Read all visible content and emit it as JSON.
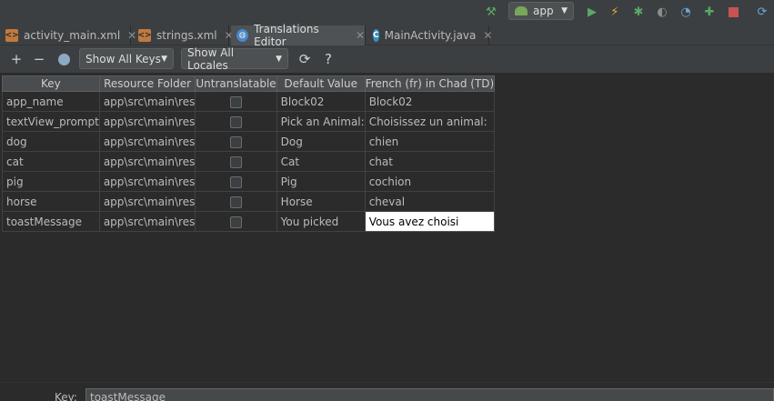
{
  "run_toolbar": {
    "config_label": "app",
    "icons": [
      "hammer-icon",
      "android-icon",
      "run-icon",
      "apply-changes-icon",
      "debug-icon",
      "coverage-icon",
      "profile-icon",
      "attach-debugger-icon",
      "stop-icon",
      "sync-icon"
    ],
    "colors": {
      "run": "#59a869",
      "stop": "#c75450",
      "debug": "#59a869",
      "hammer": "#59a869",
      "lightning": "#f0a732"
    }
  },
  "tabs": [
    {
      "label": "activity_main.xml",
      "icon": "xml-file-icon"
    },
    {
      "label": "strings.xml",
      "icon": "xml-file-icon"
    },
    {
      "label": "Translations Editor",
      "icon": "globe-icon",
      "active": true
    },
    {
      "label": "MainActivity.java",
      "icon": "class-icon"
    }
  ],
  "toolbar": {
    "add_label": "+",
    "remove_label": "−",
    "show_keys": "Show All Keys",
    "show_locales": "Show All Locales",
    "help_label": "?"
  },
  "table": {
    "headers": [
      "Key",
      "Resource Folder",
      "Untranslatable",
      "Default Value",
      "French (fr) in Chad (TD)"
    ],
    "rows": [
      {
        "key": "app_name",
        "folder": "app\\src\\main\\res",
        "untranslatable": false,
        "default": "Block02",
        "french": "Block02"
      },
      {
        "key": "textView_prompt",
        "folder": "app\\src\\main\\res",
        "untranslatable": false,
        "default": "Pick an Animal:",
        "french": "Choisissez un animal:"
      },
      {
        "key": "dog",
        "folder": "app\\src\\main\\res",
        "untranslatable": false,
        "default": "Dog",
        "french": "chien"
      },
      {
        "key": "cat",
        "folder": "app\\src\\main\\res",
        "untranslatable": false,
        "default": "Cat",
        "french": "chat"
      },
      {
        "key": "pig",
        "folder": "app\\src\\main\\res",
        "untranslatable": false,
        "default": "Pig",
        "french": "cochion"
      },
      {
        "key": "horse",
        "folder": "app\\src\\main\\res",
        "untranslatable": false,
        "default": "Horse",
        "french": "cheval"
      },
      {
        "key": "toastMessage",
        "folder": "app\\src\\main\\res",
        "untranslatable": false,
        "default": "You picked",
        "french": "Vous avez choisi",
        "editing": true
      }
    ]
  },
  "bottom": {
    "key_label": "Key:",
    "key_value": "toastMessage"
  }
}
